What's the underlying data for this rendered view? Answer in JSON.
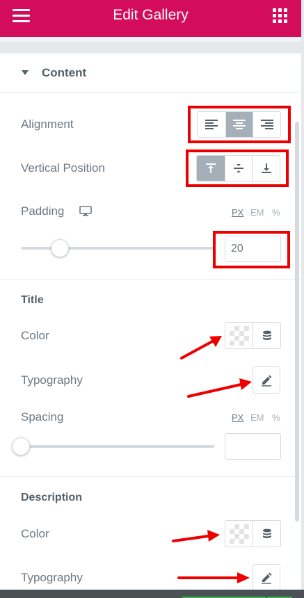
{
  "header": {
    "title": "Edit Gallery"
  },
  "content_section": {
    "label": "Content",
    "alignment": {
      "label": "Alignment",
      "options": [
        "align-left",
        "align-center",
        "align-right"
      ],
      "selected": "align-center"
    },
    "vertical_position": {
      "label": "Vertical Position",
      "options": [
        "top",
        "middle",
        "bottom"
      ],
      "selected": "top"
    },
    "padding": {
      "label": "Padding",
      "device": "desktop-icon",
      "units": [
        "PX",
        "EM",
        "%"
      ],
      "active_unit": "PX",
      "value": "20",
      "slider_fraction": 0.2
    }
  },
  "title_section": {
    "heading": "Title",
    "color_label": "Color",
    "typography_label": "Typography",
    "spacing": {
      "label": "Spacing",
      "units": [
        "PX",
        "EM",
        "%"
      ],
      "active_unit": "PX",
      "value": "",
      "slider_fraction": 0
    }
  },
  "description_section": {
    "heading": "Description",
    "color_label": "Color",
    "typography_label": "Typography"
  },
  "colors": {
    "brand": "#d30c5c",
    "highlight": "#ee0000",
    "active_button": "#a4afb7"
  }
}
